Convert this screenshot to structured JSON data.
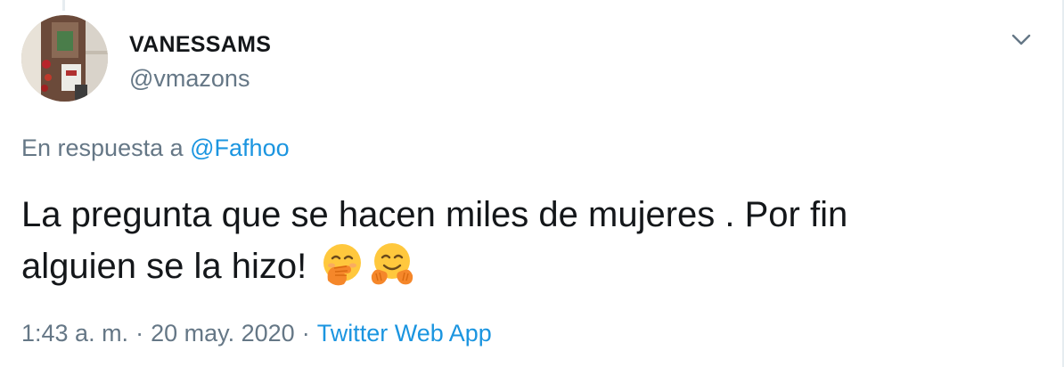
{
  "author": {
    "display_name": "VANESSAMS",
    "handle": "@vmazons",
    "avatar_icon": "avatar-photo"
  },
  "menu": {
    "caret_icon": "chevron-down-icon"
  },
  "reply": {
    "prefix": "En respuesta a",
    "mention": "@Fafhoo"
  },
  "tweet": {
    "line1": "La pregunta que se hacen miles de mujeres . Por fin",
    "line2": "alguien se la hizo!",
    "emojis": [
      "face-with-hand-over-mouth-emoji",
      "hugging-face-emoji"
    ]
  },
  "meta": {
    "time": "1:43 a. m.",
    "separator": "·",
    "date": "20 may. 2020",
    "source": "Twitter Web App"
  },
  "colors": {
    "text": "#14171a",
    "secondary": "#657786",
    "link": "#1b95e0",
    "emoji": "#ffb42b"
  }
}
